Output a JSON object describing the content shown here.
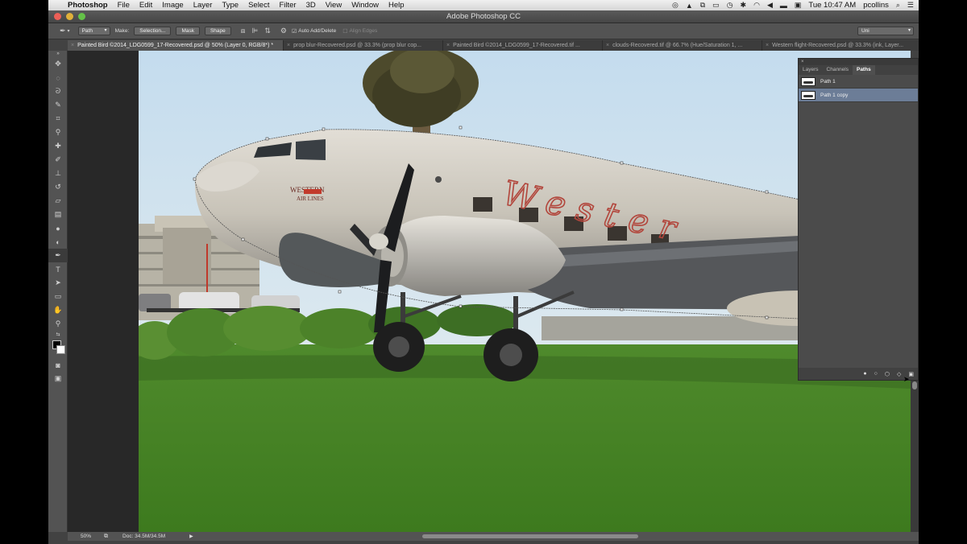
{
  "menubar": {
    "apple_glyph": "",
    "app_name": "Photoshop",
    "items": [
      "File",
      "Edit",
      "Image",
      "Layer",
      "Type",
      "Select",
      "Filter",
      "3D",
      "View",
      "Window",
      "Help"
    ],
    "clock": "Tue 10:47 AM",
    "user": "pcollins"
  },
  "window": {
    "title": "Adobe Photoshop CC"
  },
  "options": {
    "tool_mode": "Path",
    "make_label": "Make:",
    "selection_btn": "Selection...",
    "mask_btn": "Mask",
    "shape_btn": "Shape",
    "auto_add_delete": "Auto Add/Delete",
    "align_edges": "Align Edges",
    "units": "Uni"
  },
  "tabs": [
    {
      "label": "Painted Bird ©2014_LDG0599_17-Recovered.psd @ 50% (Layer 0, RGB/8*) *"
    },
    {
      "label": "prop blur-Recovered.psd @ 33.3% (prop blur cop..."
    },
    {
      "label": "Painted Bird ©2014_LDG0599_17-Recovered.tif ..."
    },
    {
      "label": "clouds-Recovered.tif @ 66.7% (Hue/Saturation 1, ..."
    },
    {
      "label": "Western flight-Recovered.psd @ 33.3% (ink, Layer..."
    }
  ],
  "statusbar": {
    "zoom": "50%",
    "doc": "Doc: 34.5M/34.5M"
  },
  "photo": {
    "fuselage_script": "Wester",
    "nose_logo_line1": "WESTERN",
    "nose_logo_line2": "AIR LINES"
  },
  "paths_panel": {
    "tabs": [
      "Layers",
      "Channels",
      "Paths"
    ],
    "active_tab": "Paths",
    "rows": [
      {
        "name": "Path 1",
        "selected": false
      },
      {
        "name": "Path 1 copy",
        "selected": true
      }
    ]
  },
  "icons": {
    "tools": [
      "move-icon",
      "marquee-icon",
      "lasso-icon",
      "quick-select-icon",
      "crop-icon",
      "eyedropper-icon",
      "healing-icon",
      "brush-icon",
      "clone-stamp-icon",
      "history-brush-icon",
      "eraser-icon",
      "gradient-icon",
      "blur-icon",
      "dodge-icon",
      "pen-icon",
      "type-icon",
      "path-select-icon",
      "rectangle-icon",
      "hand-icon",
      "zoom-icon"
    ]
  },
  "colors": {
    "panel_selection": "#6c7d97",
    "ui_dark": "#535353"
  }
}
